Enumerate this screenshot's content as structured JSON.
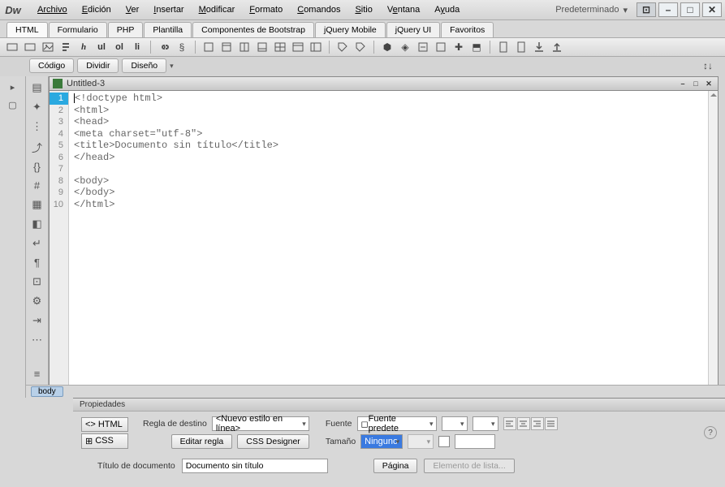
{
  "app": {
    "logo": "Dw"
  },
  "menu": [
    "Archivo",
    "Edición",
    "Ver",
    "Insertar",
    "Modificar",
    "Formato",
    "Comandos",
    "Sitio",
    "Ventana",
    "Ayuda"
  ],
  "menu_accel_index": [
    0,
    0,
    0,
    0,
    0,
    0,
    0,
    0,
    1,
    1
  ],
  "workspace": {
    "label": "Predeterminado",
    "arrow": "▾"
  },
  "doc_type_tabs": [
    "HTML",
    "Formulario",
    "PHP",
    "Plantilla",
    "Componentes de Bootstrap",
    "jQuery Mobile",
    "jQuery UI",
    "Favoritos"
  ],
  "active_doc_type_tab": 0,
  "toolbar_icons": [
    "rect",
    "rect",
    "rect-add",
    "img",
    "para",
    "h",
    "ul",
    "ol",
    "li",
    "sep",
    "link",
    "char",
    "sep",
    "box",
    "box",
    "box",
    "box",
    "box2",
    "box2",
    "box2",
    "sep",
    "tag",
    "tag",
    "sep",
    "plug",
    "plug",
    "trash",
    "trash",
    "puzzle",
    "save",
    "sep",
    "page",
    "page",
    "download",
    "upload"
  ],
  "toolbar_labels": {
    "ul": "ul",
    "ol": "ol",
    "li": "li",
    "h": "h"
  },
  "view_buttons": [
    "Código",
    "Dividir",
    "Diseño"
  ],
  "active_view_button": 0,
  "editor": {
    "title": "Untitled-3",
    "lines": [
      "<!doctype html>",
      "<html>",
      "<head>",
      "<meta charset=\"utf-8\">",
      "<title>Documento sin título</title>",
      "</head>",
      "",
      "<body>",
      "</body>",
      "</html>"
    ],
    "active_line": 1
  },
  "breadcrumb_tag": "body",
  "properties": {
    "title": "Propiedades",
    "mode_html": "HTML",
    "mode_css": "CSS",
    "rule_label": "Regla de destino",
    "rule_value": "<Nuevo estilo en línea>",
    "edit_rule_btn": "Editar regla",
    "css_designer_btn": "CSS Designer",
    "font_label": "Fuente",
    "font_value": "Fuente predete",
    "size_label": "Tamaño",
    "size_value": "Ninguno",
    "doc_title_label": "Título de documento",
    "doc_title_value": "Documento sin título",
    "page_btn": "Página",
    "list_btn": "Elemento de lista..."
  }
}
